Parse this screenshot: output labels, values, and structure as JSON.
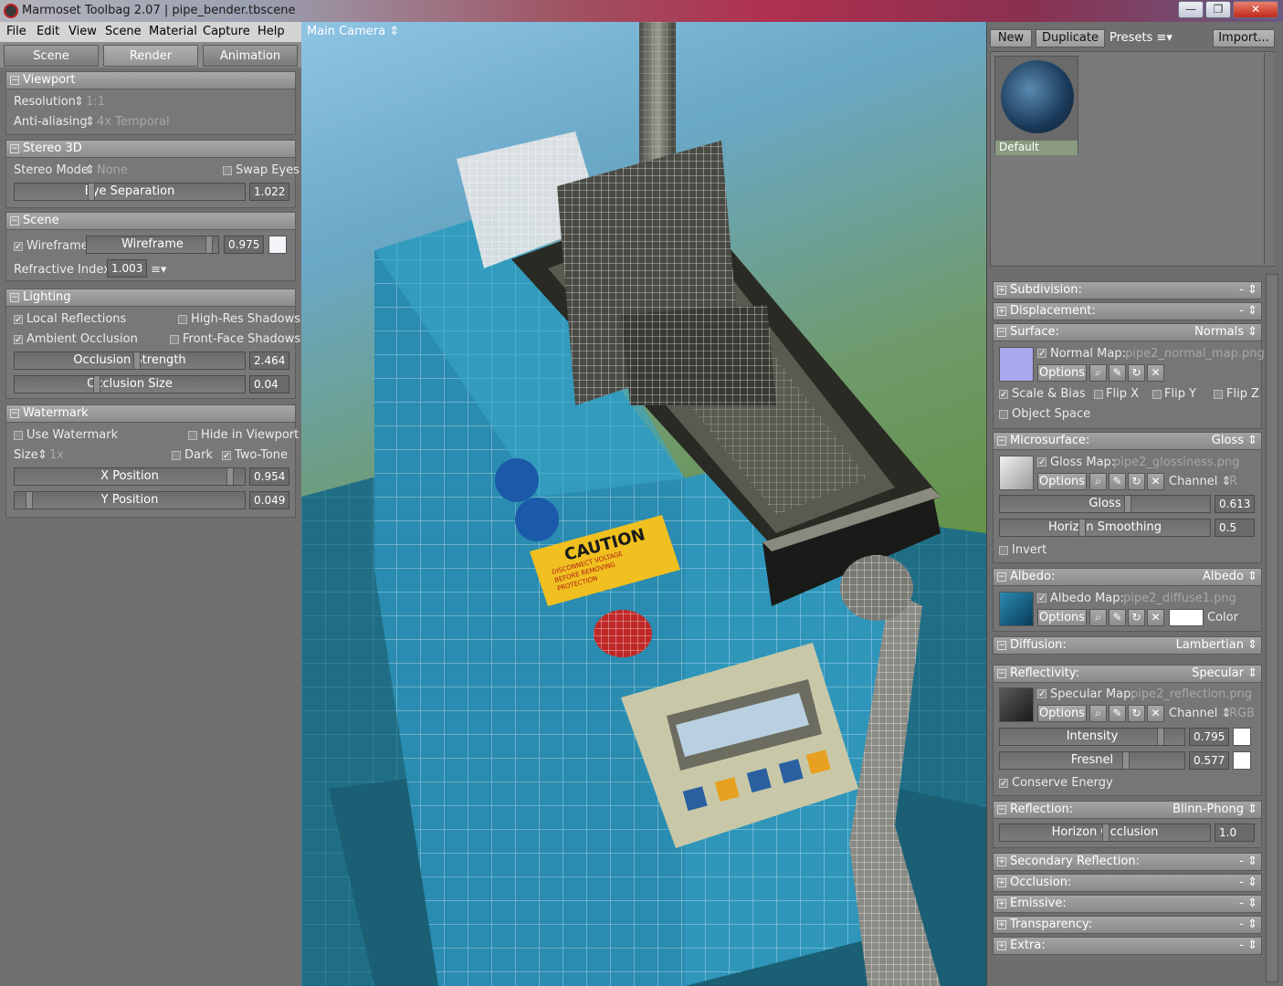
{
  "window": {
    "app_title": "Marmoset Toolbag 2.07",
    "separator": "|",
    "file_name": "pipe_bender.tbscene",
    "min": "—",
    "max": "❐",
    "close": "✕"
  },
  "menu": [
    "File",
    "Edit",
    "View",
    "Scene",
    "Material",
    "Capture",
    "Help"
  ],
  "left_tabs": [
    "Scene",
    "Render",
    "Animation"
  ],
  "viewport": {
    "title": "Viewport",
    "resolution_label": "Resolution",
    "resolution_value": "1:1",
    "aa_label": "Anti-aliasing",
    "aa_value": "4x Temporal"
  },
  "stereo": {
    "title": "Stereo 3D",
    "mode_label": "Stereo Mode",
    "mode_value": "None",
    "swap_eyes": "Swap Eyes",
    "eye_sep_label": "Eye Separation",
    "eye_sep_value": "1.022"
  },
  "scene": {
    "title": "Scene",
    "wireframe_check": "Wireframe",
    "wireframe_slider": "Wireframe",
    "wireframe_value": "0.975",
    "refr_label": "Refractive Index:",
    "refr_value": "1.003"
  },
  "lighting": {
    "title": "Lighting",
    "local_reflections": "Local Reflections",
    "high_res_shadows": "High-Res Shadows",
    "ambient_occlusion": "Ambient Occlusion",
    "front_face_shadows": "Front-Face Shadows",
    "occ_strength_label": "Occlusion Strength",
    "occ_strength_value": "2.464",
    "occ_size_label": "Occlusion Size",
    "occ_size_value": "0.04"
  },
  "watermark": {
    "title": "Watermark",
    "use": "Use Watermark",
    "hide": "Hide in Viewport",
    "size_label": "Size",
    "size_value": "1x",
    "dark": "Dark",
    "two_tone": "Two-Tone",
    "xpos_label": "X Position",
    "xpos_value": "0.954",
    "ypos_label": "Y Position",
    "ypos_value": "0.049"
  },
  "camera_label": "Main Camera",
  "right_toolbar": {
    "new": "New",
    "duplicate": "Duplicate",
    "presets": "Presets",
    "import": "Import..."
  },
  "material": {
    "name": "Default"
  },
  "sections": {
    "subdivision": {
      "label": "Subdivision:",
      "value": "-"
    },
    "displacement": {
      "label": "Displacement:",
      "value": "-"
    },
    "surface": {
      "label": "Surface:",
      "value": "Normals",
      "map_label": "Normal Map:",
      "map_file": "pipe2_normal_map.png",
      "options": "Options",
      "scale_bias": "Scale & Bias",
      "flip_x": "Flip X",
      "flip_y": "Flip Y",
      "flip_z": "Flip Z",
      "object_space": "Object Space"
    },
    "microsurface": {
      "label": "Microsurface:",
      "value": "Gloss",
      "map_label": "Gloss Map:",
      "map_file": "pipe2_glossiness.png",
      "options": "Options",
      "channel_label": "Channel",
      "channel_value": "R",
      "gloss_label": "Gloss",
      "gloss_value": "0.613",
      "horizon_label": "Horizon Smoothing",
      "horizon_value": "0.5",
      "invert": "Invert"
    },
    "albedo": {
      "label": "Albedo:",
      "value": "Albedo",
      "map_label": "Albedo Map:",
      "map_file": "pipe2_diffuse1.png",
      "options": "Options",
      "color_label": "Color"
    },
    "diffusion": {
      "label": "Diffusion:",
      "value": "Lambertian"
    },
    "reflectivity": {
      "label": "Reflectivity:",
      "value": "Specular",
      "map_label": "Specular Map:",
      "map_file": "pipe2_reflection.png",
      "options": "Options",
      "channel_label": "Channel",
      "channel_value": "RGB",
      "intensity_label": "Intensity",
      "intensity_value": "0.795",
      "fresnel_label": "Fresnel",
      "fresnel_value": "0.577",
      "conserve": "Conserve Energy"
    },
    "reflection": {
      "label": "Reflection:",
      "value": "Blinn-Phong",
      "horizon_label": "Horizon Occlusion",
      "horizon_value": "1.0"
    },
    "secondary_reflection": {
      "label": "Secondary Reflection:",
      "value": "-"
    },
    "occlusion": {
      "label": "Occlusion:",
      "value": "-"
    },
    "emissive": {
      "label": "Emissive:",
      "value": "-"
    },
    "transparency": {
      "label": "Transparency:",
      "value": "-"
    },
    "extra": {
      "label": "Extra:",
      "value": "-"
    }
  },
  "caution_sign": {
    "title": "CAUTION",
    "line1": "DISCONNECT VOLTAGE",
    "line2": "BEFORE REMOVING",
    "line3": "PROTECTION"
  },
  "colors": {
    "machine_blue": "#2a8cb0",
    "accent_red": "#c02818",
    "caution_yellow": "#f0c020"
  }
}
